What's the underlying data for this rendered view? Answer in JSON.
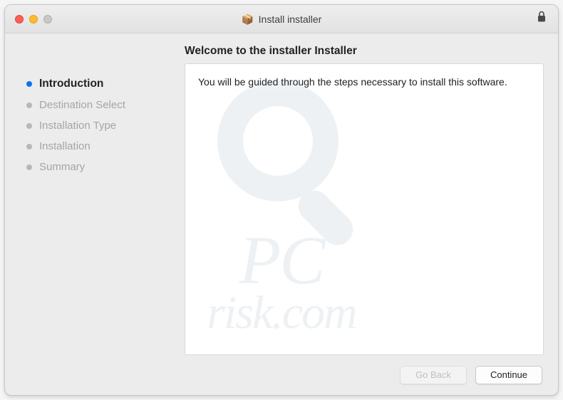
{
  "window": {
    "title": "Install installer"
  },
  "heading": "Welcome to the installer Installer",
  "sidebar": {
    "steps": [
      {
        "label": "Introduction",
        "active": true
      },
      {
        "label": "Destination Select",
        "active": false
      },
      {
        "label": "Installation Type",
        "active": false
      },
      {
        "label": "Installation",
        "active": false
      },
      {
        "label": "Summary",
        "active": false
      }
    ]
  },
  "content": {
    "body": "You will be guided through the steps necessary to install this software."
  },
  "footer": {
    "go_back_label": "Go Back",
    "continue_label": "Continue"
  },
  "watermark": {
    "line1": "PC",
    "line2": "risk.com"
  }
}
